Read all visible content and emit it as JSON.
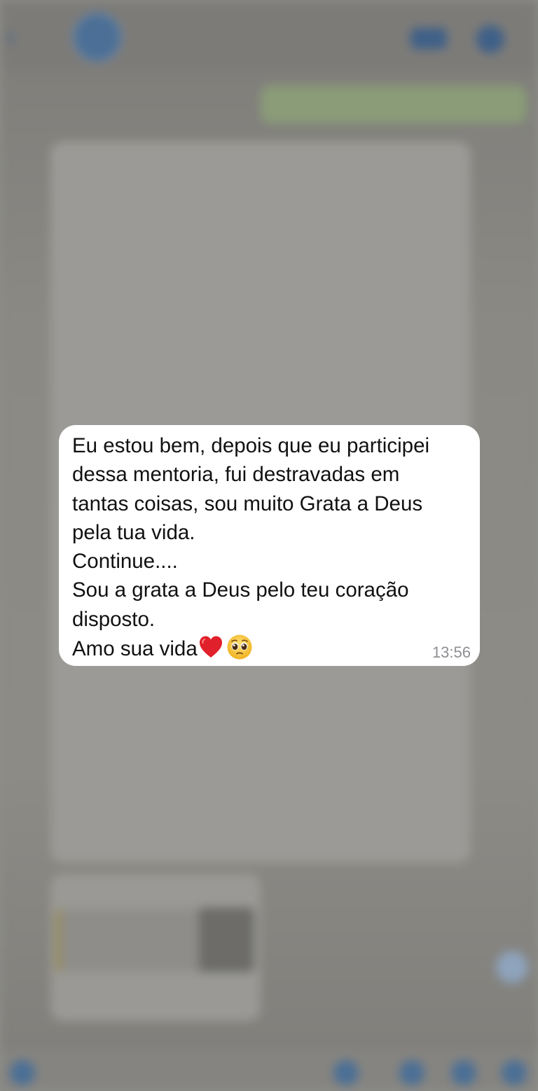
{
  "message": {
    "lines": [
      "Eu estou bem, depois que eu participei",
      "dessa mentoria, fui destravadas em",
      "tantas coisas, sou muito Grata a Deus",
      "pela tua vida.",
      "Continue....",
      "Sou a grata a Deus pelo teu coração",
      "disposto.",
      "Amo sua vida"
    ],
    "emojis": [
      "heart-emoji",
      "pleading-face-emoji"
    ],
    "time": "13:56"
  },
  "colors": {
    "bubble": "#ffffff",
    "text": "#111111",
    "time": "#8e8e93",
    "heart": "#e0202a",
    "face": "#f5c33b"
  }
}
